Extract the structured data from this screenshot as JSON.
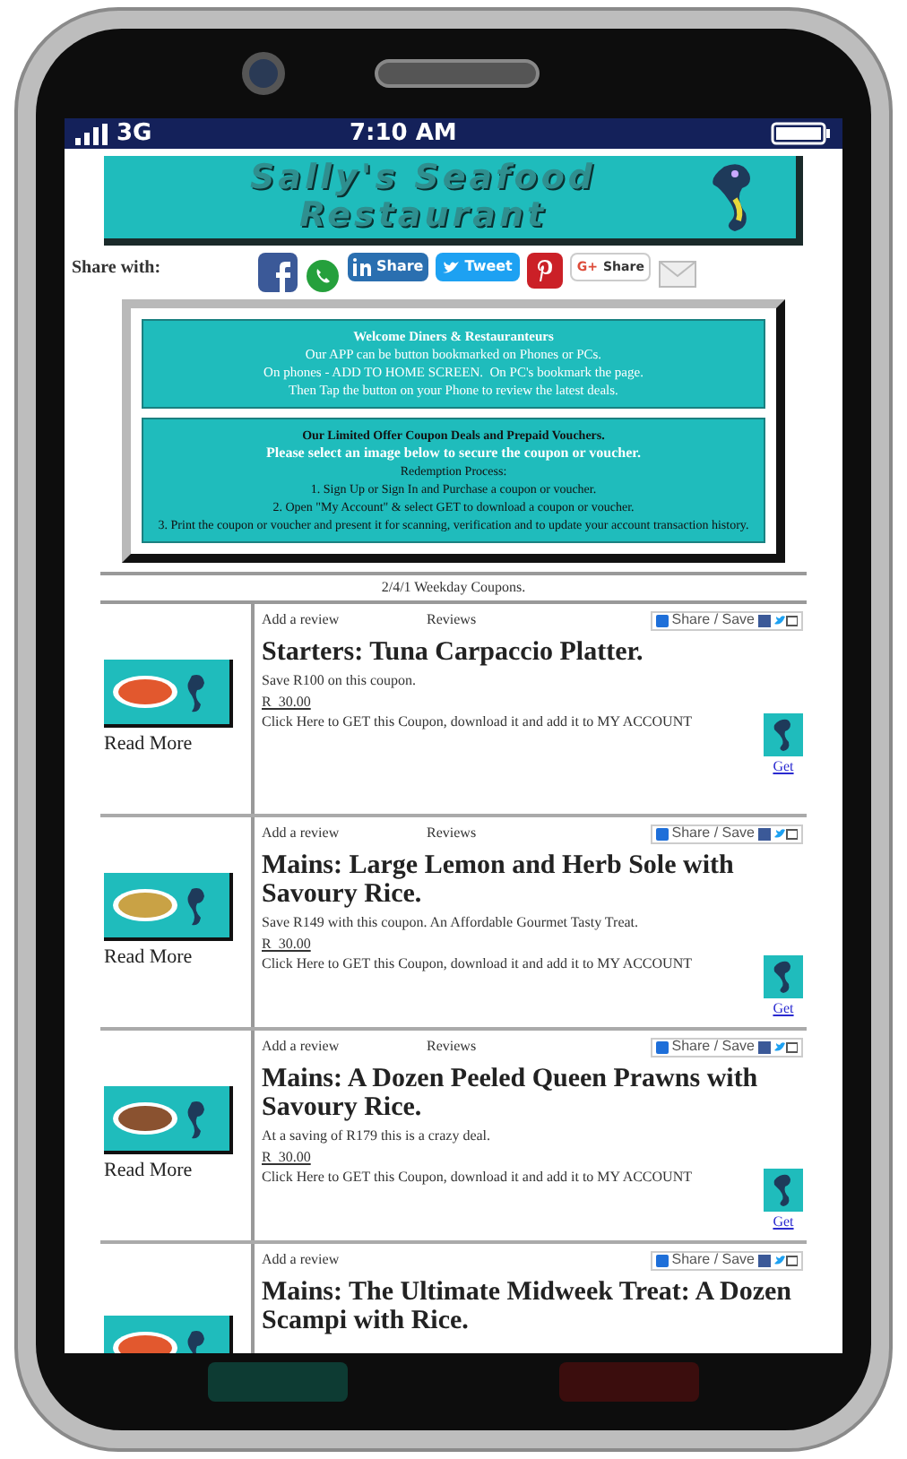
{
  "status_bar": {
    "network": "3G",
    "time": "7:10 AM"
  },
  "banner": {
    "lines": [
      "Sally's Seafood",
      "Restaurant"
    ]
  },
  "share": {
    "label": "Share with:",
    "buttons": [
      {
        "kind": "facebook"
      },
      {
        "kind": "whatsapp"
      },
      {
        "kind": "linkedin",
        "label": "Share"
      },
      {
        "kind": "twitter",
        "label": "Tweet"
      },
      {
        "kind": "pinterest"
      },
      {
        "kind": "google",
        "mark": "G+",
        "label": "Share"
      },
      {
        "kind": "email"
      }
    ]
  },
  "welcome": {
    "heading": "Welcome Diners & Restauranteurs",
    "lines": [
      "Our APP can be button bookmarked on Phones or PCs.",
      "On phones - ADD TO HOME SCREEN.  On PC's bookmark the page.",
      "Then Tap the button on your Phone to review the latest deals."
    ]
  },
  "offers": {
    "heading": "Our Limited Offer Coupon Deals and Prepaid Vouchers.",
    "subheading": "Please select an image below to secure the coupon or voucher.",
    "process_title": "Redemption Process:",
    "steps": [
      "1. Sign Up or Sign In and Purchase a coupon or voucher.",
      "2. Open \"My Account\" & select GET to download a coupon or voucher.",
      "3. Print the coupon or voucher and present it for scanning, verification and to update your account transaction history."
    ]
  },
  "coupons": {
    "title": "2/4/1 Weekday Coupons.",
    "items": [
      {
        "read_more": "Read More",
        "add_review": "Add a review",
        "reviews": "Reviews",
        "share_save": "Share / Save",
        "title": "Starters: Tuna Carpaccio Platter.",
        "description": "Save R100 on this coupon.",
        "price": "R  30.00",
        "get_text": "Click Here to GET this Coupon, download it and add it to MY ACCOUNT",
        "get_link": "Get"
      },
      {
        "read_more": "Read More",
        "add_review": "Add a review",
        "reviews": "Reviews",
        "share_save": "Share / Save",
        "title": "Mains: Large Lemon and Herb Sole with Savoury Rice.",
        "description": "Save R149 with this coupon. An Affordable Gourmet Tasty Treat.",
        "price": "R  30.00",
        "get_text": "Click Here to GET this Coupon, download it and add it to MY ACCOUNT",
        "get_link": "Get"
      },
      {
        "read_more": "Read More",
        "add_review": "Add a review",
        "reviews": "Reviews",
        "share_save": "Share / Save",
        "title": "Mains: A Dozen Peeled Queen Prawns with Savoury Rice.",
        "description": "At a saving of R179 this is a crazy deal.",
        "price": "R  30.00",
        "get_text": "Click Here to GET this Coupon, download it and add it to MY ACCOUNT",
        "get_link": "Get"
      },
      {
        "add_review": "Add a review",
        "share_save": "Share / Save",
        "title": "Mains: The Ultimate Midweek Treat: A Dozen Scampi with Rice."
      }
    ]
  }
}
